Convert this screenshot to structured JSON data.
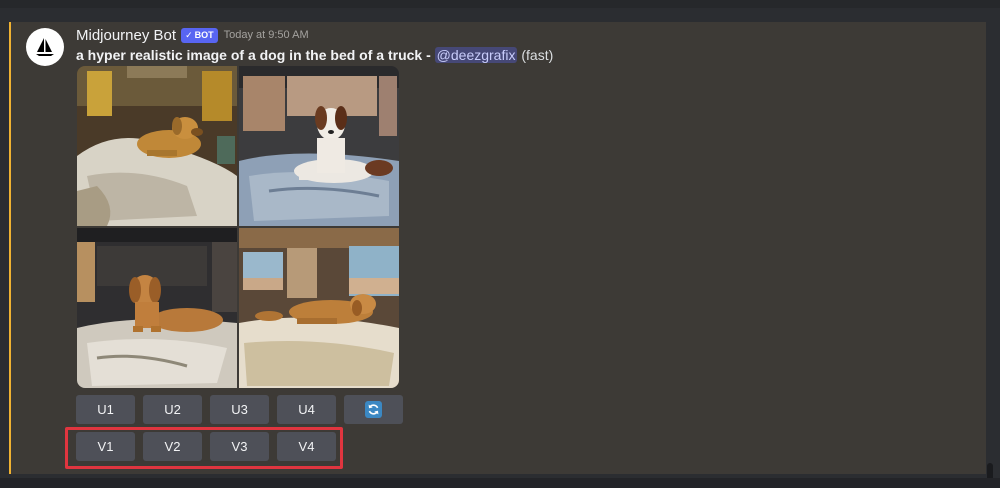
{
  "message": {
    "author": "Midjourney Bot",
    "badge": "BOT",
    "timestamp": "Today at 9:50 AM",
    "prompt": "a hyper realistic image of a dog in the bed of a truck",
    "separator": " - ",
    "mention": "@deezgrafix",
    "mode": "(fast)"
  },
  "images": [
    {
      "name": "dog-image-1",
      "subject": "golden retriever lying on blankets inside truck"
    },
    {
      "name": "dog-image-2",
      "subject": "tricolor dog lying on blue quilt in truck bed"
    },
    {
      "name": "dog-image-3",
      "subject": "golden retriever on white bedding in vehicle"
    },
    {
      "name": "dog-image-4",
      "subject": "golden retriever sleeping on bed in truck"
    }
  ],
  "upscale_buttons": [
    "U1",
    "U2",
    "U3",
    "U4"
  ],
  "variation_buttons": [
    "V1",
    "V2",
    "V3",
    "V4"
  ],
  "icons": {
    "avatar": "sailboat-icon",
    "reroll": "refresh-icon",
    "badge_check": "check-icon"
  },
  "colors": {
    "accent_bar": "#f0b232",
    "highlight": "#e0353f",
    "badge": "#5865f2"
  }
}
